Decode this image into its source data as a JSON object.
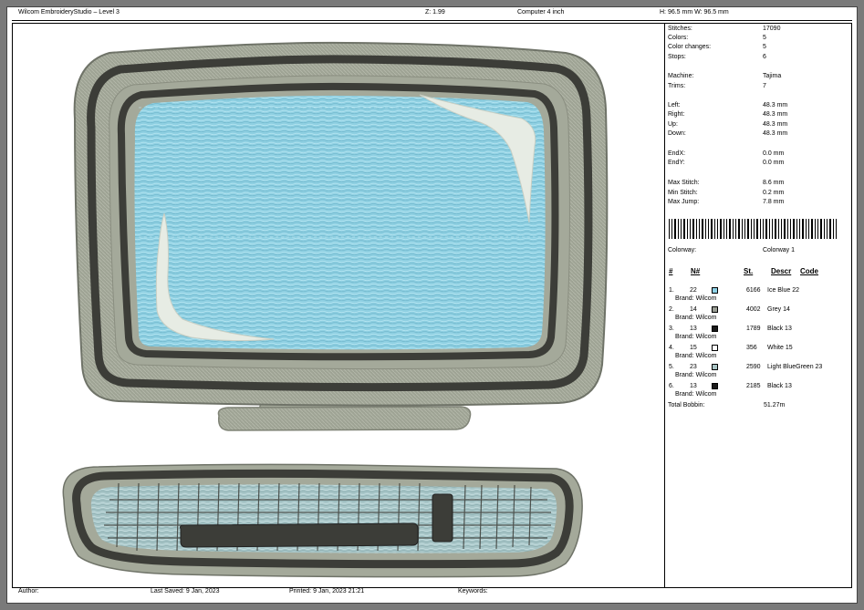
{
  "header": {
    "app_title": "Wilcom EmbroideryStudio – Level 3",
    "zoom": "Z: 1.99",
    "design_name": "Computer 4 inch",
    "dimensions": "H: 96.5 mm   W: 96.5 mm"
  },
  "stats": [
    {
      "label": "Stitches:",
      "value": "17090"
    },
    {
      "label": "Colors:",
      "value": "5"
    },
    {
      "label": "Color changes:",
      "value": "5"
    },
    {
      "label": "Stops:",
      "value": "6"
    },
    {
      "label": "Machine:",
      "value": "Tajima"
    },
    {
      "label": "Trims:",
      "value": "7"
    },
    {
      "label": "Left:",
      "value": "48.3 mm"
    },
    {
      "label": "Right:",
      "value": "48.3 mm"
    },
    {
      "label": "Up:",
      "value": "48.3 mm"
    },
    {
      "label": "Down:",
      "value": "48.3 mm"
    },
    {
      "label": "EndX:",
      "value": "0.0 mm"
    },
    {
      "label": "EndY:",
      "value": "0.0 mm"
    },
    {
      "label": "Max Stitch:",
      "value": "8.6 mm"
    },
    {
      "label": "Min Stitch:",
      "value": "0.2 mm"
    },
    {
      "label": "Max Jump:",
      "value": "7.8 mm"
    }
  ],
  "colorway": {
    "label": "Colorway:",
    "value": "Colorway 1"
  },
  "table": {
    "headers": {
      "hash": "#",
      "needle": "N#",
      "stitches": "St.",
      "descr": "Descr",
      "code": "Code"
    },
    "rows": [
      {
        "num": "1.",
        "needle": "22",
        "color": "#8ed1e6",
        "stitches": "6166",
        "descr": "Ice Blue 22",
        "brand": "Brand: Wilcom"
      },
      {
        "num": "2.",
        "needle": "14",
        "color": "#9a9e94",
        "stitches": "4002",
        "descr": "Grey 14",
        "brand": "Brand: Wilcom"
      },
      {
        "num": "3.",
        "needle": "13",
        "color": "#1a1a1a",
        "stitches": "1789",
        "descr": "Black 13",
        "brand": "Brand: Wilcom"
      },
      {
        "num": "4.",
        "needle": "15",
        "color": "#ffffff",
        "stitches": "356",
        "descr": "White 15",
        "brand": "Brand: Wilcom"
      },
      {
        "num": "5.",
        "needle": "23",
        "color": "#a9c4c4",
        "stitches": "2590",
        "descr": "Light BlueGreen 23",
        "brand": "Brand: Wilcom"
      },
      {
        "num": "6.",
        "needle": "13",
        "color": "#1a1a1a",
        "stitches": "2185",
        "descr": "Black 13",
        "brand": "Brand: Wilcom"
      }
    ]
  },
  "total_bobbin": {
    "label": "Total Bobbin:",
    "value": "51.27m"
  },
  "footer": {
    "author": "Author:",
    "last_saved": "Last Saved:  9 Jan, 2023",
    "printed": "Printed:  9 Jan, 2023 21:21",
    "keywords": "Keywords:"
  },
  "colors": {
    "monitor_grey": "#9ea394",
    "frame_dark": "#3c3d38",
    "screen_blue": "#8fd0e2",
    "keyboard_fill": "#a8c6c8"
  }
}
